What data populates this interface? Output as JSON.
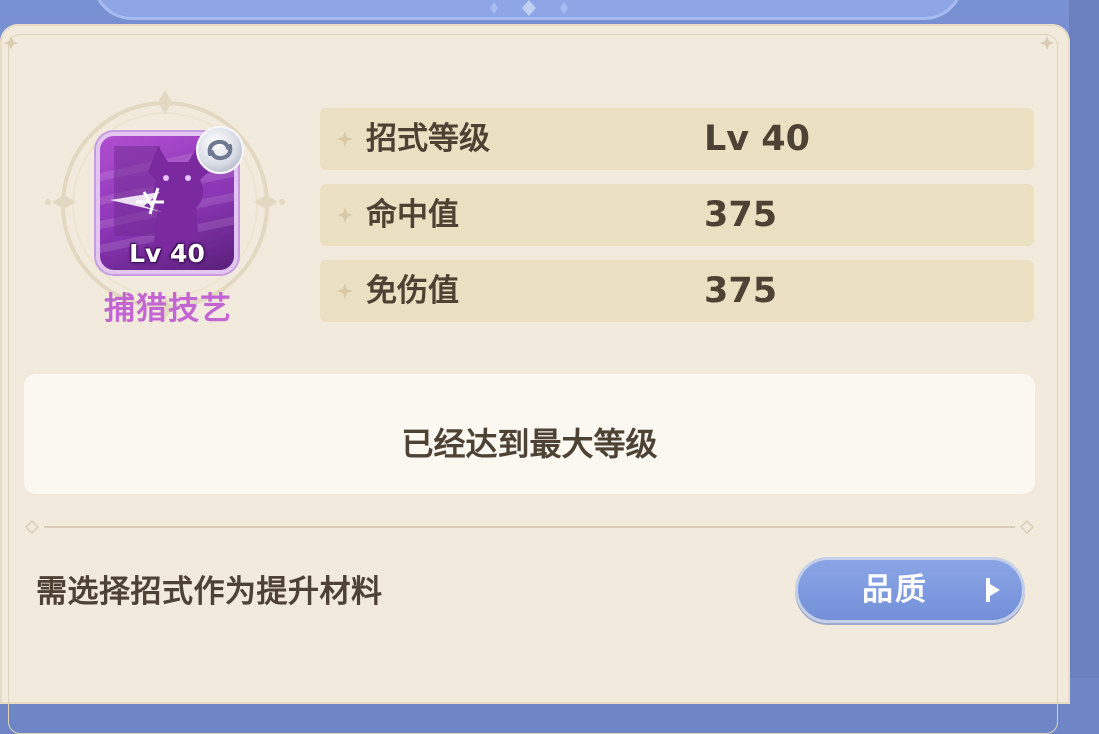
{
  "skill": {
    "level_label": "Lv 40",
    "name": "捕猎技艺"
  },
  "stats": [
    {
      "label": "招式等级",
      "value": "Lv 40"
    },
    {
      "label": "命中值",
      "value": "375"
    },
    {
      "label": "免伤值",
      "value": "375"
    }
  ],
  "max_level_message": "已经达到最大等级",
  "requirement_text": "需选择招式作为提升材料",
  "quality_button": {
    "label": "品质"
  },
  "colors": {
    "panel_bg": "#f2ebdd",
    "stat_row_bg": "#ece0c3",
    "text_brown": "#4e4235",
    "skill_name_purple": "#c366d4",
    "button_blue": "#7f9adf",
    "frame_blue": "#6f86c6"
  },
  "icons": {
    "skill": "cat-claw-skill-icon",
    "badge": "quality-ring-icon",
    "bullet": "sparkle-icon",
    "button": "sort-triangle-icon"
  }
}
